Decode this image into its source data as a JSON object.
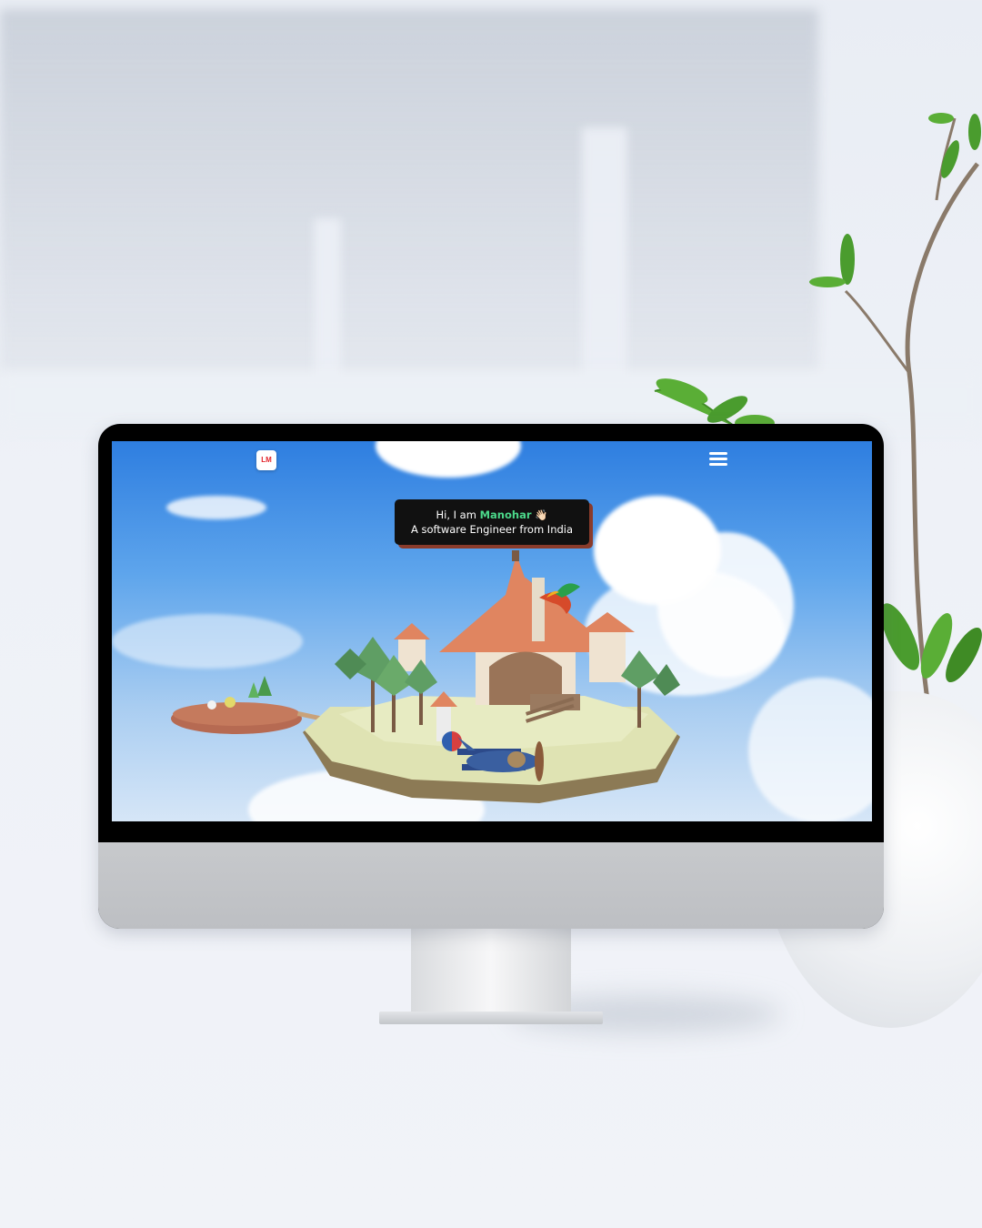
{
  "website": {
    "logo_text": "LM",
    "greeting": {
      "prefix": "Hi, I am",
      "name": "Manohar",
      "emoji": "👋🏻",
      "subtitle": "A software Engineer from India"
    },
    "menu_icon": "hamburger-menu-icon",
    "accent_color": "#4bd88a",
    "logo_color": "#e3242b"
  },
  "scene": {
    "icons": [
      "cloud-icon",
      "island-icon",
      "house-icon",
      "airplane-icon",
      "bird-icon",
      "tree-icon"
    ]
  }
}
